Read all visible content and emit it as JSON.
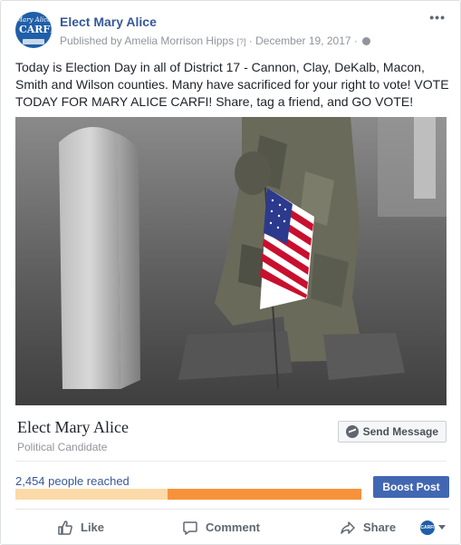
{
  "post": {
    "page_name": "Elect Mary Alice",
    "published_by": "Published by Amelia Morrison Hipps",
    "help_marker": "[?]",
    "date": "December 19, 2017",
    "separator": "·",
    "more_label": "•••",
    "body_text": "Today is Election Day in all of District 17 - Cannon, Clay, DeKalb, Macon, Smith and Wilson counties. Many have sacrificed for your right to vote! VOTE TODAY FOR MARY ALICE CARFI! Share, tag a friend, and GO VOTE!",
    "avatar": {
      "line1": "Mary Alice",
      "line2": "CARFI"
    }
  },
  "card": {
    "title": "Elect Mary Alice",
    "subtitle": "Political Candidate",
    "send_label": "Send Message"
  },
  "reach": {
    "label": "2,454 people reached",
    "organic_fraction": 0.44,
    "boost_label": "Boost Post"
  },
  "actions": {
    "like": "Like",
    "comment": "Comment",
    "share": "Share",
    "viewer_mini": "CARFI"
  },
  "colors": {
    "link_blue": "#365899",
    "boost_blue": "#4267b2",
    "reach_orange": "#f7923a",
    "reach_light": "#fcd9a8"
  },
  "icons": [
    "globe-icon",
    "more-icon",
    "messenger-icon",
    "like-icon",
    "comment-icon",
    "share-icon",
    "chevron-down-icon"
  ]
}
